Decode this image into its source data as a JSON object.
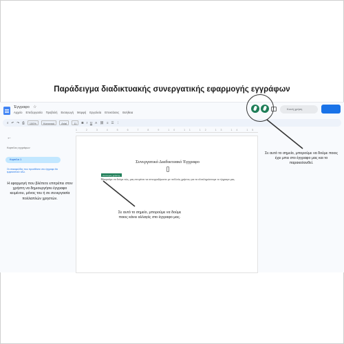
{
  "heading": "Παράδειγμα διαδικτυακής συνεργατικής εφαρμογής εγγράφων",
  "app": {
    "doc_name": "Έγγραφο",
    "menu": [
      "Αρχείο",
      "Επεξεργασία",
      "Προβολή",
      "Εισαγωγή",
      "Μορφή",
      "Εργαλεία",
      "Επεκτάσεις",
      "Βοήθεια"
    ],
    "meet_label": "Κοινή χρήση",
    "toolbar": {
      "zoom": "100%",
      "style": "Κανονικό",
      "font": "Arial",
      "font_size": "11"
    },
    "ruler": "1 2 3 4 5 6 7 8 9 10 11 12 13 14 15"
  },
  "sidebar": {
    "heading": "Καρτέλες εγγράφων",
    "tab_label": "Καρτέλα 1",
    "hint": "Οι επικεφαλίδες που προσθέτετε στο έγγραφο θα εμφανιστούν εδώ."
  },
  "document": {
    "title": "Συνεργατικό Διαδικτυακό Έγγραφο",
    "collaborator_flag": "Ανώνυμος χρήστης",
    "body": "Μπορούμε να δούμε πώς, μας επιτρέπει να συνεργαζόμαστε με πολλούς χρήστες για να ολοκληρώσουμε το έγγραφο μας."
  },
  "annotations": {
    "left": "Η εφαρμογή που βλέπετε επιτρέπει στον χρήστη να δημιουργήσει έγγραφο κειμένου, μόνος του ή σε συνεργασία πολλαπλών χρηστών.",
    "middle": "Σε αυτό το σημείο, μπορούμε να δούμε ποιος κάνει αλλαγές στο έγγραφο μας.",
    "right": "Σε αυτό το σημείο, μπορούμε να δούμε ποιος έχει μπει στο έγγραφο μας και το παρακολουθεί."
  },
  "colors": {
    "accent": "#1a73e8",
    "collaborator": "#1e7e58"
  }
}
